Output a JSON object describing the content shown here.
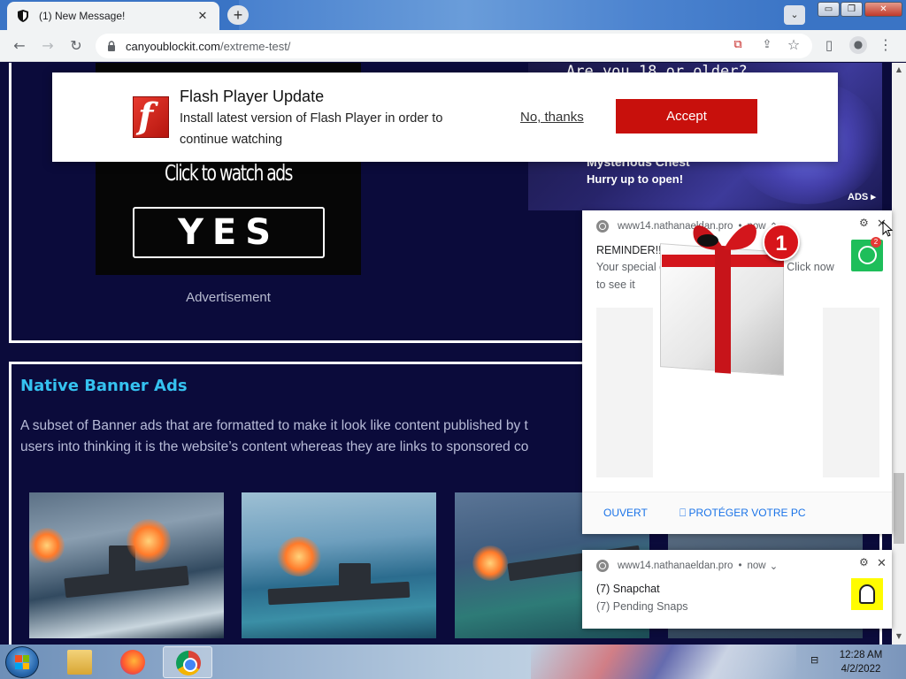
{
  "browser": {
    "tab_title": "(1) New Message!",
    "tab_close": "✕",
    "new_tab": "+",
    "tab_search": "⌄",
    "url_domain": "canyoublockit.com",
    "url_path": "/extreme-test/",
    "window_controls": {
      "minimize": "▭",
      "maximize": "❐",
      "close": "✕"
    },
    "nav": {
      "back": "←",
      "forward": "→",
      "reload": "↻"
    },
    "toolbar_icons": [
      "popup-blocked-icon",
      "share-icon",
      "star-icon",
      "sidepanel-icon",
      "profile-icon",
      "menu-icon"
    ],
    "toolbar_glyphs": {
      "popup": "⧉",
      "share": "⇪",
      "star": "☆",
      "sidepanel": "▯",
      "profile": "●",
      "menu": "⋮"
    }
  },
  "page": {
    "ad_left": {
      "headline": "Click to watch ads",
      "button": "YES",
      "caption": "Advertisement"
    },
    "ad_right": {
      "top_text": "Are you 18 or older?",
      "title": "Mysterious Chest",
      "subtitle": "Hurry up to open!",
      "badge": "ADS ▸"
    },
    "native": {
      "title": "Native Banner Ads",
      "desc_line1": "A subset of Banner ads that are formatted to make it look like content published by t",
      "desc_line2": "users into thinking it is the website’s content whereas they are links to sponsored co"
    },
    "thumbnails": [
      "warship-thumbnail-1",
      "warship-thumbnail-2",
      "warship-thumbnail-3",
      "warship-thumbnail-4"
    ]
  },
  "flash_popup": {
    "title": "Flash Player Update",
    "body": "Install latest version of Flash Player in order to continue watching",
    "decline": "No, thanks",
    "accept": "Accept",
    "icon_letter": "f",
    "accept_color": "#c8100c"
  },
  "notifications": [
    {
      "source": "www14.nathanaeldan.pro",
      "time": "now",
      "caret": "⌃",
      "title": "REMINDER!!!",
      "body": "Your special gift won't be here forever! Click now to see it",
      "badge_count": "2",
      "image_badge": "1",
      "actions": [
        "OUVERT",
        "⎕ PROTÉGER VOTRE PC"
      ]
    },
    {
      "source": "www14.nathanaeldan.pro",
      "time": "now",
      "caret": "⌄",
      "title": "(7) Snapchat",
      "body": "(7) Pending Snaps"
    }
  ],
  "notification_controls": {
    "gear": "⚙",
    "close": "✕",
    "dot": "•"
  },
  "scrollbar": {
    "up": "▲",
    "down": "▼"
  },
  "taskbar": {
    "apps": [
      "windows-explorer",
      "firefox",
      "chrome"
    ],
    "clock_time": "12:28 AM",
    "clock_date": "4/2/2022",
    "network": "⊟"
  }
}
